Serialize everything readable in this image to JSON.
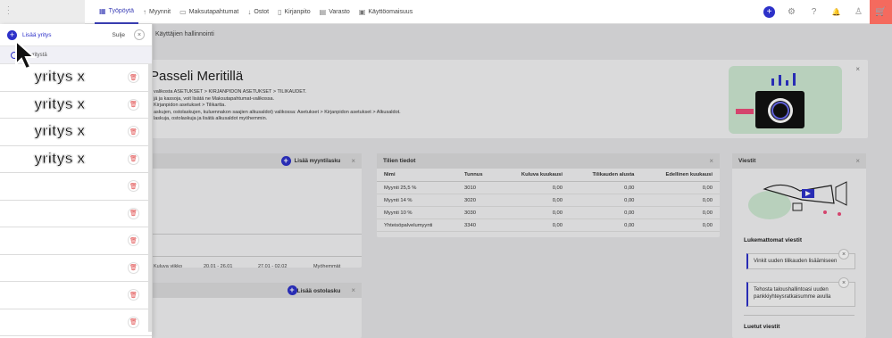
{
  "nav": {
    "items": [
      {
        "label": "Työpöytä",
        "icon": "grid-icon",
        "glyph": "▦",
        "active": true
      },
      {
        "label": "Myynnit",
        "icon": "arrow-up-icon",
        "glyph": "↑",
        "active": false
      },
      {
        "label": "Maksutapahtumat",
        "icon": "card-icon",
        "glyph": "▭",
        "active": false
      },
      {
        "label": "Ostot",
        "icon": "arrow-down-icon",
        "glyph": "↓",
        "active": false
      },
      {
        "label": "Kirjanpito",
        "icon": "book-icon",
        "glyph": "▯",
        "active": false
      },
      {
        "label": "Varasto",
        "icon": "warehouse-icon",
        "glyph": "▤",
        "active": false
      },
      {
        "label": "Käyttöomaisuus",
        "icon": "asset-icon",
        "glyph": "▣",
        "active": false
      }
    ],
    "actions": {
      "settings_glyph": "⚙",
      "help_glyph": "?",
      "bell_glyph": "🔔",
      "user_glyph": "♙",
      "cart_glyph": "🛒",
      "plus_glyph": "+"
    }
  },
  "breadcrumb": "Käyttäjien hallinnointi",
  "welcome": {
    "title": "Passeli Meritillä",
    "lines": [
      "valikosta ASETUKSET > KIRJANPIDON ASETUKSET > TILIKAUDET.",
      "jä ja kassoja, voit lisätä ne Maksutapahtumat-valikossa.",
      "Kirjanpidon asetukset > Tilikartta.",
      "askujen, ostolaskujen, kuluennakon saajien alkusaldot) valikossa: Asetukset > Kirjanpidon asetukset > Alkusaldot.",
      "laskuja, ostolaskuja ja lisätä alkusaldot myöhemmin."
    ],
    "close": "×"
  },
  "sales": {
    "add_label": "Lisää myyntilasku",
    "columns": [
      "Kuluva viikko",
      "20.01 - 26.01",
      "27.01 - 02.02",
      "Myöhemmät"
    ],
    "close": "×"
  },
  "purchases": {
    "add_label": "Lisää ostolasku",
    "close": "×"
  },
  "accounts": {
    "title": "Tilien tiedot",
    "close": "×",
    "headers": [
      "Nimi",
      "Tunnus",
      "Kuluva kuukausi",
      "Tilikauden alusta",
      "Edellinen kuukausi"
    ],
    "rows": [
      [
        "Myynti 25,5 %",
        "3010",
        "0,00",
        "0,00",
        "0,00"
      ],
      [
        "Myynti 14 %",
        "3020",
        "0,00",
        "0,00",
        "0,00"
      ],
      [
        "Myynti 10 %",
        "3030",
        "0,00",
        "0,00",
        "0,00"
      ],
      [
        "Yhteisöpalvelumyynti",
        "3340",
        "0,00",
        "0,00",
        "0,00"
      ]
    ]
  },
  "messages": {
    "title": "Viestit",
    "close": "×",
    "unread_heading": "Lukemattomat viestit",
    "unread": [
      "Vinkit uuden tilikauden lisäämiseen",
      "Tehosta taloushallintoasi uuden pankkiyhteysratkaisumme avulla"
    ],
    "read_heading": "Luetut viestit"
  },
  "panel": {
    "add_label": "Lisää yritys",
    "close_label": "Sulje",
    "sub_label": "aje yritystä",
    "companies": [
      "yritys x",
      "yritys x",
      "yritys x",
      "yritys x",
      "",
      "",
      "",
      "",
      "",
      ""
    ],
    "trash_glyph": "🗑"
  }
}
